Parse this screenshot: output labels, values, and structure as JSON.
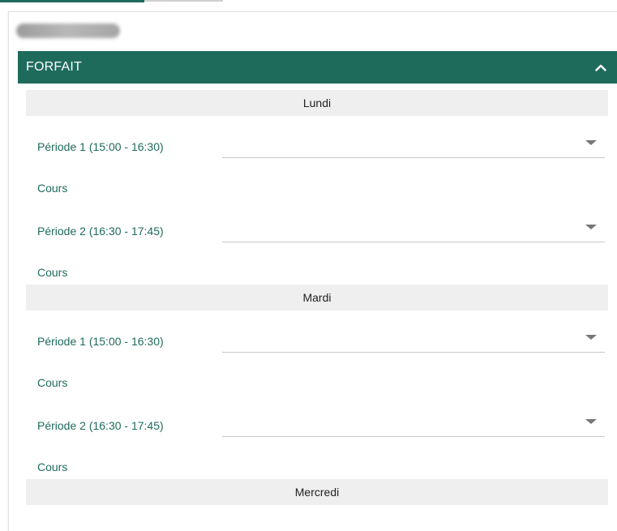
{
  "section": {
    "title": "FORFAIT"
  },
  "days": [
    {
      "name": "Lundi",
      "periods": [
        {
          "label": "Période 1 (15:00 - 16:30)",
          "value": "",
          "cours_label": "Cours"
        },
        {
          "label": "Période 2 (16:30 - 17:45)",
          "value": "",
          "cours_label": "Cours"
        }
      ]
    },
    {
      "name": "Mardi",
      "periods": [
        {
          "label": "Période 1 (15:00 - 16:30)",
          "value": "",
          "cours_label": "Cours"
        },
        {
          "label": "Période 2 (16:30 - 17:45)",
          "value": "",
          "cours_label": "Cours"
        }
      ]
    },
    {
      "name": "Mercredi",
      "periods": []
    }
  ],
  "colors": {
    "accent": "#1e6b5c",
    "day_header_bg": "#efefef"
  },
  "icons": {
    "collapse": "chevron-up-icon",
    "select": "caret-down-icon"
  }
}
